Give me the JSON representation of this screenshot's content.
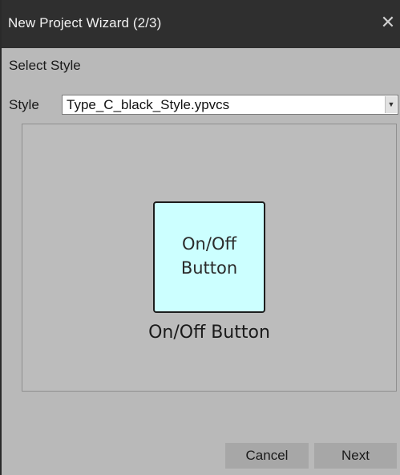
{
  "window": {
    "title": "New Project Wizard (2/3)",
    "close_glyph": "✕"
  },
  "section": {
    "label": "Select Style"
  },
  "style_selector": {
    "label": "Style",
    "value": "Type_C_black_Style.ypvcs",
    "arrow_glyph": "▼"
  },
  "preview": {
    "button_line1": "On/Off",
    "button_line2": "Button",
    "caption": "On/Off Button",
    "button_color": "#ccffff"
  },
  "footer": {
    "cancel_label": "Cancel",
    "next_label": "Next"
  }
}
